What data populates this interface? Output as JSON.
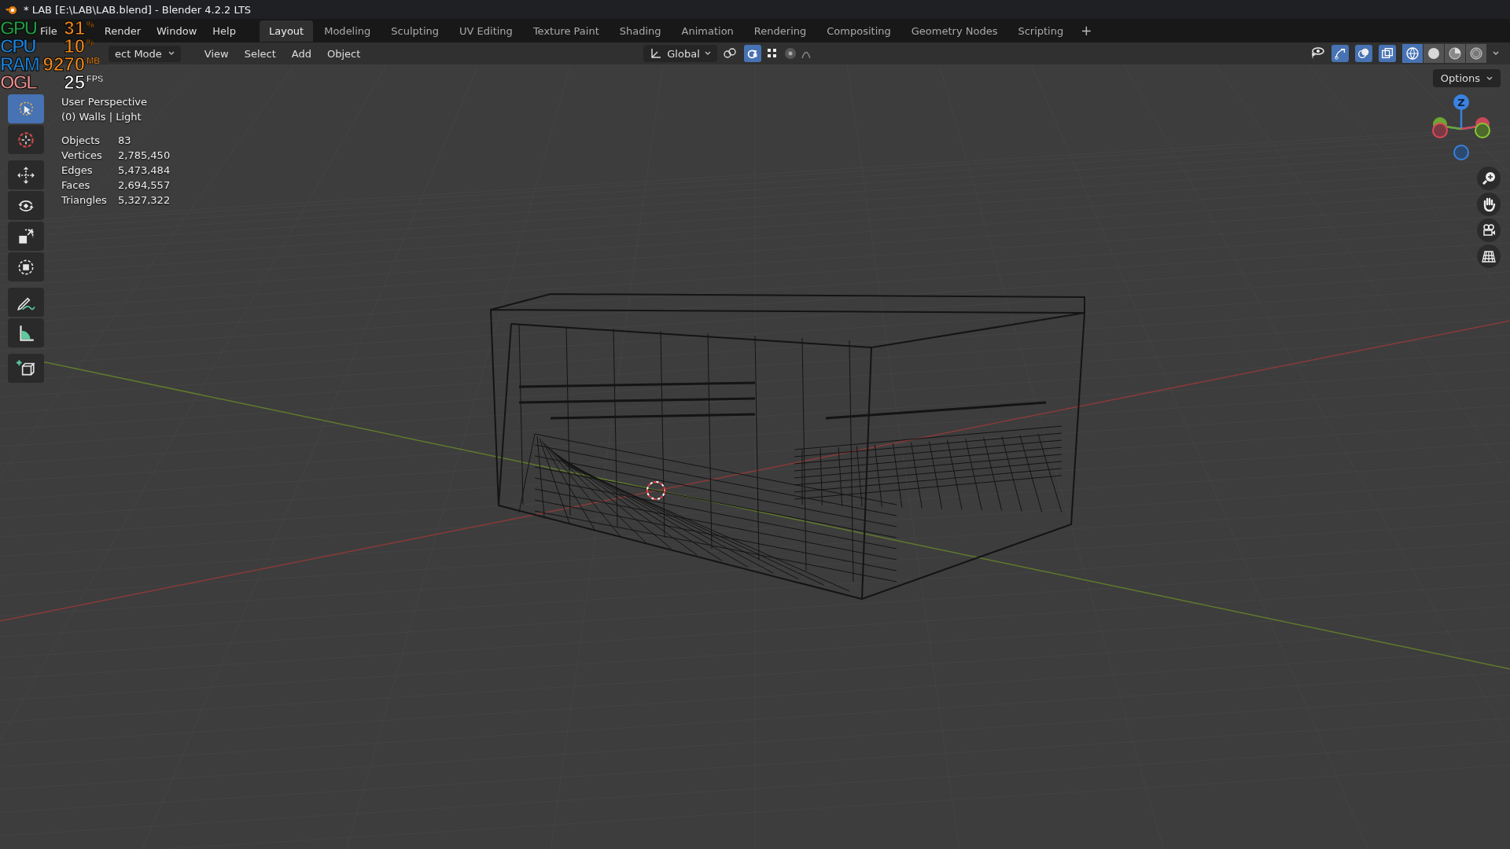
{
  "window": {
    "title": "* LAB [E:\\LAB\\LAB.blend] - Blender 4.2.2 LTS"
  },
  "menu": [
    "File",
    "Render",
    "Window",
    "Help"
  ],
  "workspaces": [
    {
      "label": "Layout",
      "selected": true
    },
    {
      "label": "Modeling",
      "selected": false
    },
    {
      "label": "Sculpting",
      "selected": false
    },
    {
      "label": "UV Editing",
      "selected": false
    },
    {
      "label": "Texture Paint",
      "selected": false
    },
    {
      "label": "Shading",
      "selected": false
    },
    {
      "label": "Animation",
      "selected": false
    },
    {
      "label": "Rendering",
      "selected": false
    },
    {
      "label": "Compositing",
      "selected": false
    },
    {
      "label": "Geometry Nodes",
      "selected": false
    },
    {
      "label": "Scripting",
      "selected": false
    }
  ],
  "add_workspace": "+",
  "header": {
    "mode": "ect Mode",
    "menus": [
      "View",
      "Select",
      "Add",
      "Object"
    ],
    "orientation": "Global"
  },
  "toggles": [
    {
      "kind": "snap",
      "on": true
    },
    {
      "kind": "gizmos",
      "on": true
    },
    {
      "kind": "overlays",
      "on": true
    },
    {
      "kind": "xray",
      "on": true
    }
  ],
  "shading": [
    {
      "kind": "wireframe",
      "selected": true
    },
    {
      "kind": "solid",
      "selected": false
    },
    {
      "kind": "material",
      "selected": false
    },
    {
      "kind": "rendered",
      "selected": false
    }
  ],
  "monitor": [
    {
      "label": "GPU",
      "value": "31",
      "unit": "%",
      "color": "#1f9a44",
      "kind": "usage"
    },
    {
      "label": "CPU",
      "value": "10",
      "unit": "%",
      "color": "#1c82d6",
      "kind": "usage"
    },
    {
      "label": "RAM",
      "value": "9270",
      "unit": "MB",
      "color": "#1c82d6",
      "kind": "usage"
    },
    {
      "label": "OGL",
      "value": "25",
      "unit": "FPS",
      "color": "#e08c8c",
      "kind": "rate"
    }
  ],
  "viewport": {
    "view": "User Perspective",
    "collection": "(0) Walls | Light",
    "stats": [
      {
        "label": "Objects",
        "value": "83"
      },
      {
        "label": "Vertices",
        "value": "2,785,450"
      },
      {
        "label": "Edges",
        "value": "5,473,484"
      },
      {
        "label": "Faces",
        "value": "2,694,557"
      },
      {
        "label": "Triangles",
        "value": "5,327,322"
      }
    ],
    "options": "Options",
    "gizmo_label": "Z"
  },
  "tools": [
    {
      "kind": "select",
      "selected": true
    },
    {
      "kind": "cursor",
      "selected": false
    },
    {
      "kind": "move",
      "selected": false
    },
    {
      "kind": "rotate",
      "selected": false
    },
    {
      "kind": "scale",
      "selected": false
    },
    {
      "kind": "transform",
      "selected": false
    },
    {
      "kind": "annotate",
      "selected": false
    },
    {
      "kind": "measure",
      "selected": false
    },
    {
      "kind": "add-cube",
      "selected": false
    }
  ]
}
